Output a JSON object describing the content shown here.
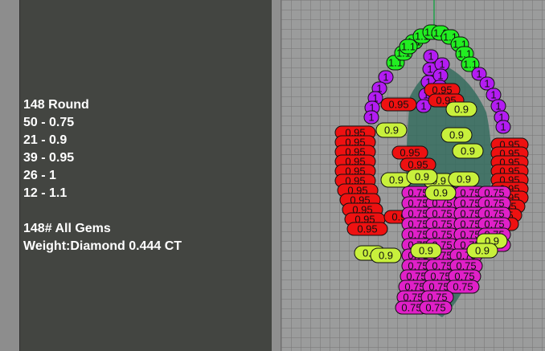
{
  "gem_summary": {
    "lines": [
      "148 Round",
      "50 - 0.75",
      "21 - 0.9",
      "39 - 0.95",
      "26 - 1",
      "12 - 1.1",
      "",
      "148# All Gems",
      "Weight:Diamond 0.444 CT"
    ]
  },
  "viewport": {
    "size_labels": [
      "0.75",
      "0.9",
      "0.95",
      "1",
      "1.1"
    ],
    "colors": {
      "0.75": "#e020c8",
      "0.9": "#c8f03c",
      "0.95": "#ee1111",
      "1": "#b31cf2",
      "1.1": "#22ee22",
      "grid_bg": "#9b9c9c",
      "panel_bg": "#434541",
      "axis": "#1fa04a"
    }
  }
}
